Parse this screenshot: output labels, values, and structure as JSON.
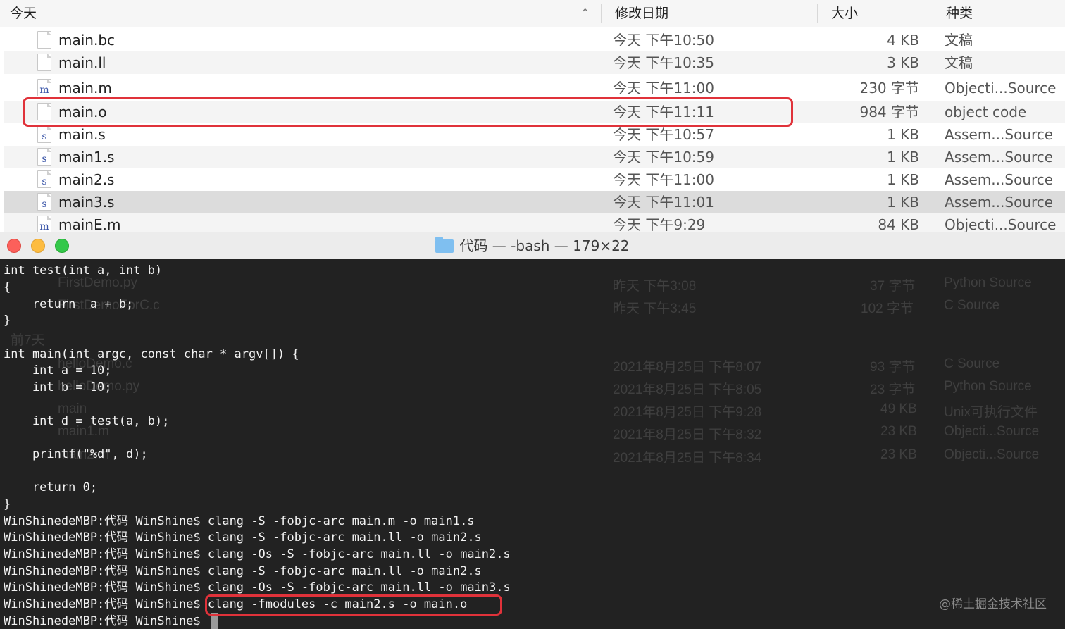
{
  "finder": {
    "headers": {
      "name": "今天",
      "date": "修改日期",
      "size": "大小",
      "kind": "种类"
    },
    "rows": [
      {
        "icon": "",
        "name": "main.bc",
        "date": "今天 下午10:50",
        "size": "4 KB",
        "kind": "文稿"
      },
      {
        "icon": "",
        "name": "main.ll",
        "date": "今天 下午10:35",
        "size": "3 KB",
        "kind": "文稿"
      },
      {
        "icon": "m",
        "name": "main.m",
        "date": "今天 下午11:00",
        "size": "230 字节",
        "kind": "Objecti...Source"
      },
      {
        "icon": "",
        "name": "main.o",
        "date": "今天 下午11:11",
        "size": "984 字节",
        "kind": "object code"
      },
      {
        "icon": "s",
        "name": "main.s",
        "date": "今天 下午10:57",
        "size": "1 KB",
        "kind": "Assem...Source"
      },
      {
        "icon": "s",
        "name": "main1.s",
        "date": "今天 下午10:59",
        "size": "1 KB",
        "kind": "Assem...Source"
      },
      {
        "icon": "s",
        "name": "main2.s",
        "date": "今天 下午11:00",
        "size": "1 KB",
        "kind": "Assem...Source"
      },
      {
        "icon": "s",
        "name": "main3.s",
        "date": "今天 下午11:01",
        "size": "1 KB",
        "kind": "Assem...Source"
      },
      {
        "icon": "m",
        "name": "mainE.m",
        "date": "今天 下午9:29",
        "size": "84 KB",
        "kind": "Objecti...Source"
      }
    ]
  },
  "terminal": {
    "title": "代码 — -bash — 179×22",
    "lines": [
      "int test(int a, int b)",
      "{",
      "    return  a + b;",
      "}",
      "",
      "int main(int argc, const char * argv[]) {",
      "    int a = 10;",
      "    int b = 10;",
      "",
      "    int d = test(a, b);",
      "",
      "    printf(\"%d\", d);",
      "",
      "    return 0;",
      "}",
      "WinShinedeMBP:代码 WinShine$ clang -S -fobjc-arc main.m -o main1.s",
      "WinShinedeMBP:代码 WinShine$ clang -S -fobjc-arc main.ll -o main2.s",
      "WinShinedeMBP:代码 WinShine$ clang -Os -S -fobjc-arc main.ll -o main2.s",
      "WinShinedeMBP:代码 WinShine$ clang -S -fobjc-arc main.ll -o main2.s",
      "WinShinedeMBP:代码 WinShine$ clang -Os -S -fobjc-arc main.ll -o main3.s",
      "WinShinedeMBP:代码 WinShine$ clang -fmodules -c main2.s -o main.o",
      "WinShinedeMBP:代码 WinShine$ "
    ],
    "ghost_rows": [
      {
        "name": "FirstDemo.py",
        "date": "昨天 下午3:08",
        "size": "37 字节",
        "kind": "Python Source"
      },
      {
        "name": "FirstDemoForC.c",
        "date": "昨天 下午3:45",
        "size": "102 字节",
        "kind": "C Source"
      },
      {
        "name": "前7天",
        "date": "",
        "size": "",
        "kind": ""
      },
      {
        "name": "helloDemo.c",
        "date": "2021年8月25日 下午8:07",
        "size": "93 字节",
        "kind": "C Source"
      },
      {
        "name": "helloDemo.py",
        "date": "2021年8月25日 下午8:05",
        "size": "23 字节",
        "kind": "Python Source"
      },
      {
        "name": "main",
        "date": "2021年8月25日 下午9:28",
        "size": "49 KB",
        "kind": "Unix可执行文件"
      },
      {
        "name": "main1.m",
        "date": "2021年8月25日 下午8:32",
        "size": "23 KB",
        "kind": "Objecti...Source"
      },
      {
        "name": "main2.m",
        "date": "2021年8月25日 下午8:34",
        "size": "23 KB",
        "kind": "Objecti...Source"
      }
    ]
  },
  "watermark": "@稀土掘金技术社区"
}
